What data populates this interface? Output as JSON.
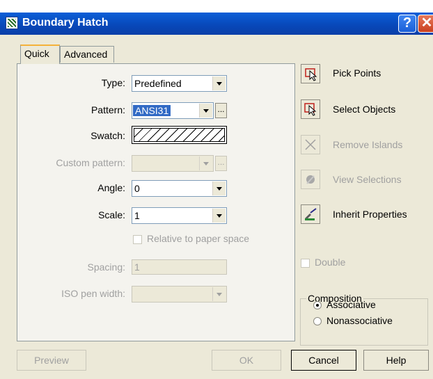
{
  "window": {
    "title": "Boundary Hatch",
    "help_glyph": "?",
    "close_glyph": "✕"
  },
  "tabs": [
    {
      "label": "Quick",
      "active": true
    },
    {
      "label": "Advanced",
      "active": false
    }
  ],
  "quick": {
    "type": {
      "label": "Type:",
      "value": "Predefined"
    },
    "pattern": {
      "label": "Pattern:",
      "value": "ANSI31",
      "browse_label": "..."
    },
    "swatch": {
      "label": "Swatch:"
    },
    "custom_pattern": {
      "label": "Custom pattern:",
      "value": "",
      "browse_label": "..."
    },
    "angle": {
      "label": "Angle:",
      "value": "0"
    },
    "scale": {
      "label": "Scale:",
      "value": "1"
    },
    "relative": {
      "label": "Relative to paper space",
      "checked": false
    },
    "spacing": {
      "label": "Spacing:",
      "value": "1"
    },
    "iso_pen": {
      "label": "ISO pen width:",
      "value": ""
    }
  },
  "side": {
    "pick_points": "Pick Points",
    "select_objects": "Select Objects",
    "remove_islands": "Remove Islands",
    "view_selections": "View Selections",
    "inherit_properties": "Inherit Properties",
    "double": {
      "label": "Double",
      "checked": false
    },
    "composition": {
      "title": "Composition",
      "associative": "Associative",
      "nonassociative": "Nonassociative",
      "selected": "Associative"
    }
  },
  "buttons": {
    "preview": "Preview",
    "ok": "OK",
    "cancel": "Cancel",
    "help": "Help"
  },
  "colors": {
    "title_bar": "#0a5fd8",
    "selection": "#316ac5",
    "dialog_bg": "#ece9d8"
  }
}
